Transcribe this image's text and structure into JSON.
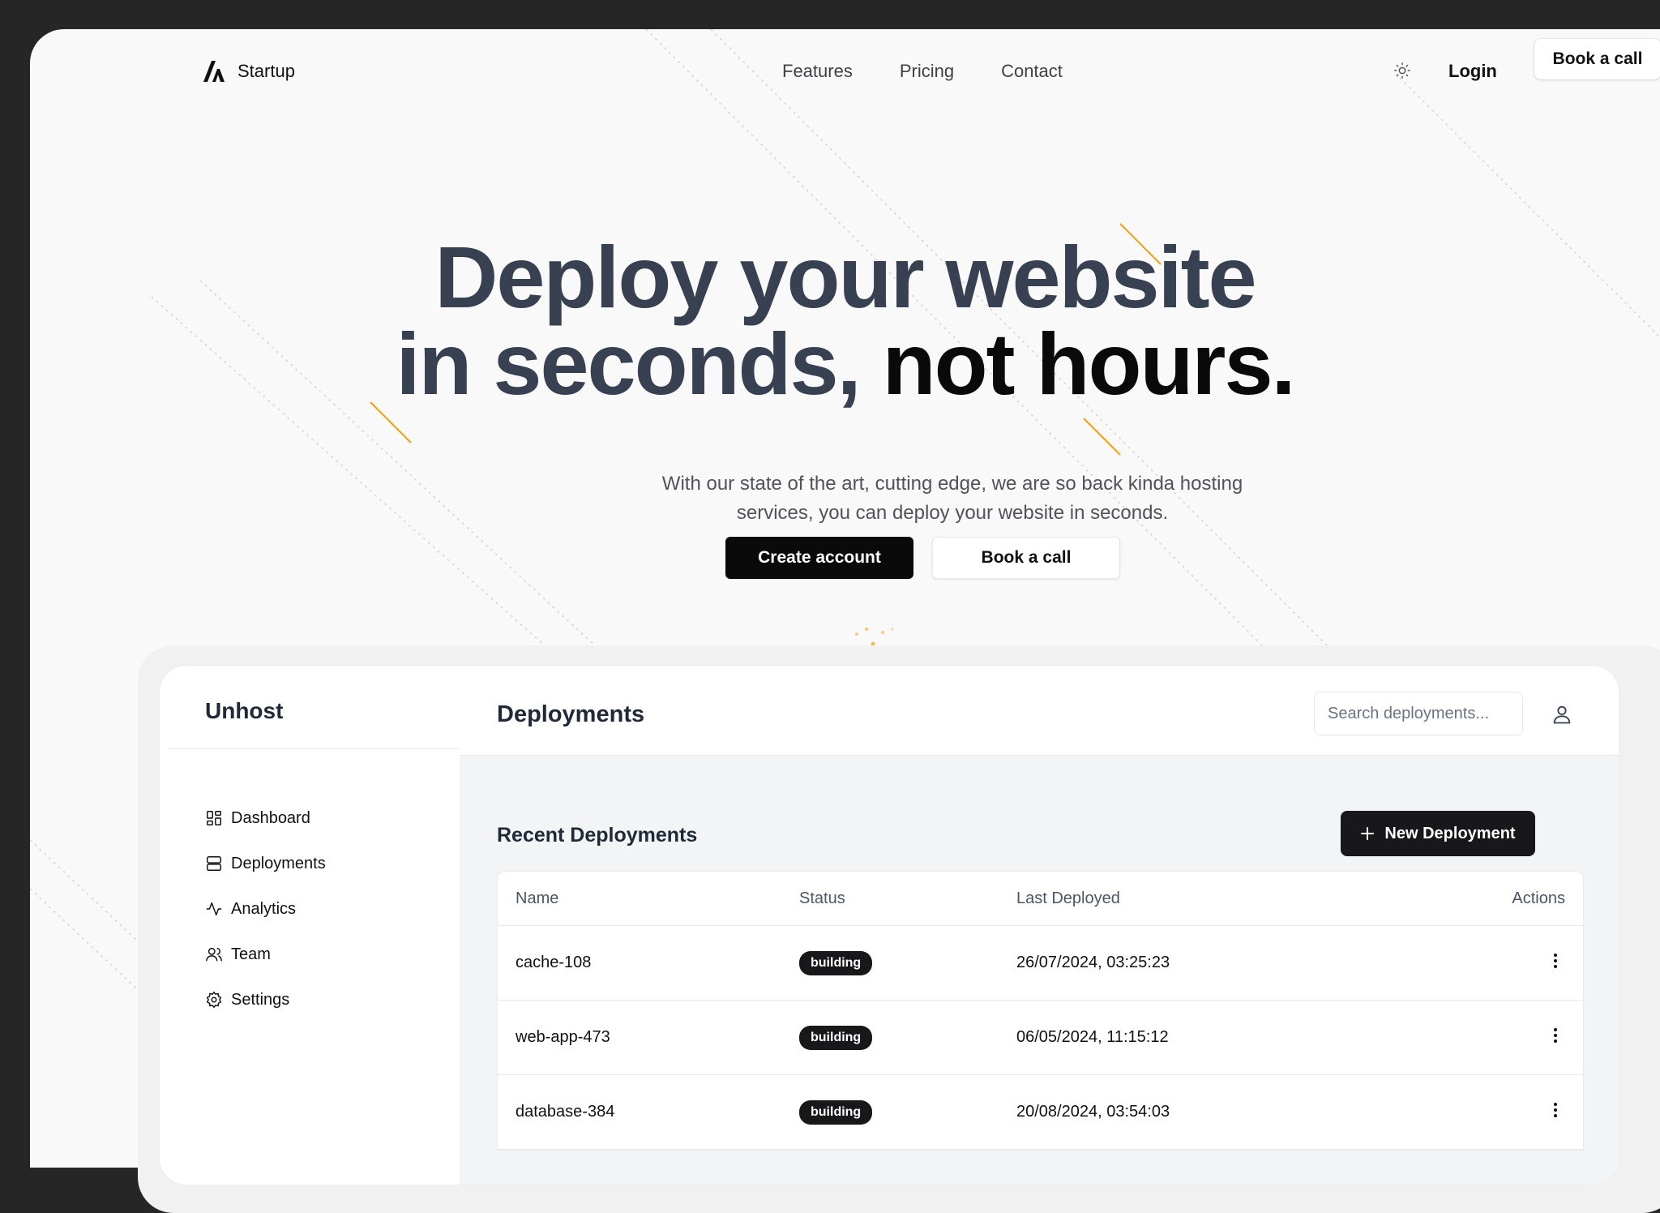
{
  "nav": {
    "brand": "Startup",
    "links": [
      "Features",
      "Pricing",
      "Contact"
    ],
    "login": "Login",
    "book": "Book a call"
  },
  "hero": {
    "title_line1": "Deploy your website",
    "title_line2_a": "in seconds, ",
    "title_line2_b": "not hours.",
    "subtitle": "With our state of the art, cutting edge, we are so back kinda hosting services, you can deploy your website in seconds.",
    "primary_cta": "Create account",
    "secondary_cta": "Book a call"
  },
  "dashboard": {
    "brand": "Unhost",
    "sidebar": [
      {
        "label": "Dashboard",
        "icon": "grid-icon"
      },
      {
        "label": "Deployments",
        "icon": "server-icon"
      },
      {
        "label": "Analytics",
        "icon": "activity-icon"
      },
      {
        "label": "Team",
        "icon": "users-icon"
      },
      {
        "label": "Settings",
        "icon": "gear-icon"
      }
    ],
    "page_title": "Deployments",
    "search_placeholder": "Search deployments...",
    "section_title": "Recent Deployments",
    "new_button": "New Deployment",
    "columns": [
      "Name",
      "Status",
      "Last Deployed",
      "Actions"
    ],
    "rows": [
      {
        "name": "cache-108",
        "status": "building",
        "date": "26/07/2024, 03:25:23"
      },
      {
        "name": "web-app-473",
        "status": "building",
        "date": "06/05/2024, 11:15:12"
      },
      {
        "name": "database-384",
        "status": "building",
        "date": "20/08/2024, 03:54:03"
      }
    ]
  },
  "colors": {
    "background": "#262626",
    "page": "#f9f9f9",
    "accent": "#f59e0b",
    "heading": "#374151",
    "primary": "#0a0a0a"
  }
}
